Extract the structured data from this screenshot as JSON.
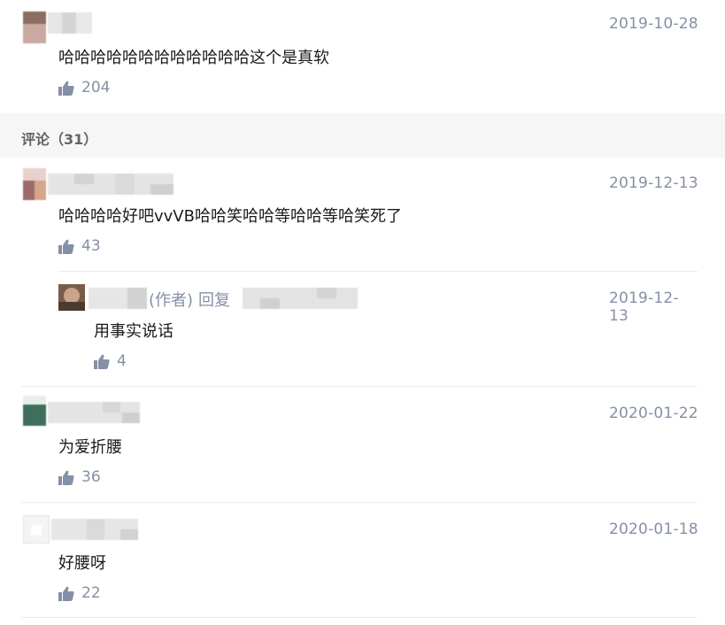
{
  "top_comment": {
    "date": "2019-10-28",
    "text": "哈哈哈哈哈哈哈哈哈哈哈哈这个是真软",
    "likes": "204"
  },
  "comments_section": {
    "title": "评论（31）"
  },
  "comments": [
    {
      "date": "2019-12-13",
      "text": "哈哈哈哈好吧vvVB哈哈笑哈哈等哈哈等哈笑死了",
      "likes": "43",
      "reply": {
        "author_tag": "(作者)",
        "reply_word": "回复",
        "date": "2019-12-13",
        "text": "用事实说话",
        "likes": "4"
      }
    },
    {
      "date": "2020-01-22",
      "text": "为爱折腰",
      "likes": "36"
    },
    {
      "date": "2020-01-18",
      "text": "好腰呀",
      "likes": "22"
    }
  ],
  "colors": {
    "meta_gray": "#8590a6",
    "section_bg": "#f6f6f6",
    "divider": "#ececec"
  },
  "icons": [
    "thumbs-up-icon"
  ]
}
